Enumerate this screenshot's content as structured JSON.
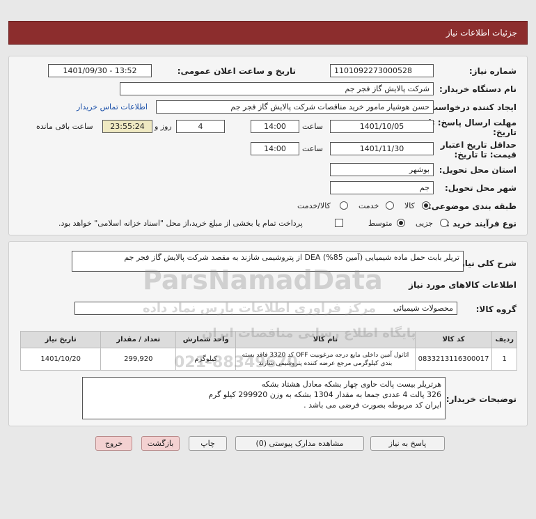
{
  "header": {
    "title": "جزئیات اطلاعات نیاز"
  },
  "fields": {
    "need_number_label": "شماره نیاز:",
    "need_number": "1101092273000528",
    "announce_label": "تاریخ و ساعت اعلان عمومی:",
    "announce_value": "1401/09/30 - 13:52",
    "buyer_org_label": "نام دستگاه خریدار:",
    "buyer_org": "شرکت پالایش گاز فجر جم",
    "creator_label": "ایجاد کننده درخواست:",
    "creator": "حسن هوشیار مامور خرید مناقصات شرکت پالایش گاز فجر جم",
    "contact_link": "اطلاعات تماس خریدار",
    "deadline_label_1": "مهلت ارسال پاسخ: تا",
    "deadline_label_2": "تاریخ:",
    "deadline_date": "1401/10/05",
    "time_label": "ساعت",
    "deadline_time": "14:00",
    "days_value": "4",
    "days_label": "روز و",
    "remaining_time": "23:55:24",
    "remaining_label": "ساعت باقی مانده",
    "validity_label_1": "حداقل تاریخ اعتبار",
    "validity_label_2": "قیمت: تا تاریخ:",
    "validity_date": "1401/11/30",
    "validity_time_label": "ساعت",
    "validity_time": "14:00",
    "province_label": "استان محل تحویل:",
    "province": "بوشهر",
    "city_label": "شهر محل تحویل:",
    "city": "جم",
    "category_label": "طبقه بندی موضوعی:",
    "category_options": [
      "کالا",
      "خدمت",
      "کالا/خدمت"
    ],
    "category_selected": "کالا",
    "process_label": "نوع فرآیند خرید :",
    "process_options": [
      "جزیی",
      "متوسط"
    ],
    "process_selected": "متوسط",
    "payment_note": "پرداخت تمام یا بخشی از مبلغ خرید،از محل \"اسناد خزانه اسلامی\" خواهد بود."
  },
  "summary": {
    "label": "شرح کلی نیاز:",
    "text": "تریلر بابت حمل ماده شیمیایی (آمین DEA (%85 از پتروشیمی شازند به مقصد شرکت پالایش گاز فجر جم"
  },
  "goods": {
    "section_title": "اطلاعات کالاهای مورد نیاز",
    "group_label": "گروه کالا:",
    "group_value": "محصولات شیمیائی",
    "columns": [
      "ردیف",
      "کد کالا",
      "نام کالا",
      "واحد شمارش",
      "تعداد / مقدار",
      "تاریخ نیاز"
    ],
    "rows": [
      {
        "index": "1",
        "code": "0833213116300017",
        "name": "اتانول آمین داخلی مایع درجه مرغوبیت OFF کد 3320 فاقد بسته بندی کیلوگرمی مرجع عرضه کننده پتروشیمی شازند",
        "unit": "کیلوگرم",
        "qty": "299,920",
        "date": "1401/10/20"
      }
    ]
  },
  "buyer_notes": {
    "label": "توضیحات خریدار:",
    "lines": [
      "هرتریلر بیست پالت حاوی چهار بشکه  معادل هشتاد بشکه",
      "326 پالت 4 عددی جمعا به مقدار 1304 بشکه  به وزن 299920 کیلو گرم",
      "ایران کد مربوطه بصورت فرضی می باشد ."
    ]
  },
  "buttons": {
    "reply": "پاسخ به نیاز",
    "attachments": "مشاهده مدارک پیوستی (0)",
    "print": "چاپ",
    "back": "بازگشت",
    "exit": "خروج"
  },
  "watermark": {
    "brand": "ParsNamadData",
    "sub": "مرکز فراوری اطلاعات پارس نماد داده",
    "tag": "پایگاه اطلاع رسانی مناقصات ایران",
    "phone": "021-88349670"
  },
  "colors": {
    "header_bg": "#8c2d2d",
    "link": "#1a4fa8",
    "remaining_bg": "#efe9c2"
  }
}
